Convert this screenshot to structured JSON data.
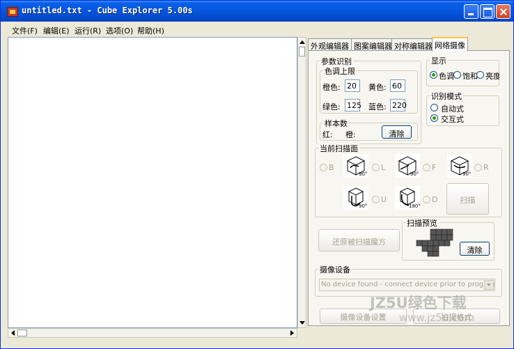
{
  "window": {
    "title": "untitled.txt - Cube Explorer 5.00s"
  },
  "menu": [
    "文件(F)",
    "编辑(E)",
    "运行(R)",
    "选项(O)",
    "帮助(H)"
  ],
  "tabs": [
    "外观编辑器",
    "图案编辑器",
    "对称编辑器",
    "网络摄像"
  ],
  "params": {
    "title": "参数识别",
    "hue_title": "色调上限",
    "orange_label": "橙色:",
    "orange_value": "20",
    "yellow_label": "黄色:",
    "yellow_value": "60",
    "green_label": "绿色:",
    "green_value": "125",
    "blue_label": "蓝色:",
    "blue_value": "220",
    "sample_title": "样本数",
    "red_label": "红:",
    "orange2_label": "橙:",
    "clear_label": "清除"
  },
  "display": {
    "title": "显示",
    "options": [
      "色调",
      "饱和",
      "亮度"
    ],
    "selected": "色调"
  },
  "mode": {
    "title": "识别模式",
    "options": [
      "自动式",
      "交互式"
    ],
    "selected": "交互式"
  },
  "scan": {
    "title": "当前扫描面",
    "faces": [
      {
        "letter": "B",
        "angle": "90°"
      },
      {
        "letter": "L",
        "angle": "90°"
      },
      {
        "letter": "F",
        "angle": "90°"
      },
      {
        "letter": "R",
        "angle": ""
      },
      {
        "letter": "U",
        "angle": "90°"
      },
      {
        "letter": "D",
        "angle": "180°"
      }
    ],
    "scan_button": "扫描"
  },
  "restore_button": "还原被扫描魔方",
  "preview": {
    "title": "扫描预览",
    "clear_label": "清除"
  },
  "camera": {
    "title": "摄像设备",
    "device": "No device found - connect device prior to program start!"
  },
  "footer": {
    "settings_button": "摄像设备设置",
    "format_button": "拍摄格式"
  },
  "watermark": {
    "line1": "JZ5U绿色下载",
    "line2": "www.jz5u.com"
  },
  "colors": {
    "titlebar": "#0556DE",
    "face": "#ECE9D8",
    "tab_highlight": "#FFC73C",
    "radio_check": "#21A121"
  }
}
